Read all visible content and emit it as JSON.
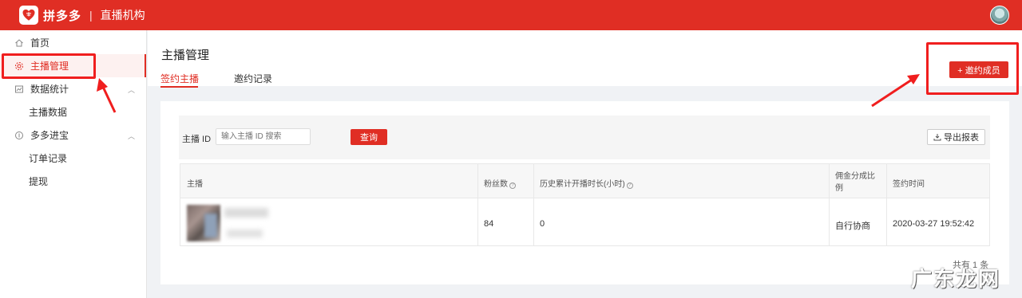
{
  "header": {
    "brand": "拼多多",
    "separator": "|",
    "subtitle": "直播机构"
  },
  "sidebar": {
    "items": [
      {
        "label": "首页",
        "icon": "home-icon"
      },
      {
        "label": "主播管理",
        "icon": "gear-icon",
        "active": true
      },
      {
        "label": "数据统计",
        "icon": "chart-icon"
      },
      {
        "label": "主播数据",
        "sub": true
      },
      {
        "label": "多多进宝",
        "icon": "coin-icon"
      },
      {
        "label": "订单记录",
        "sub": true
      },
      {
        "label": "提现",
        "sub": true
      }
    ]
  },
  "main": {
    "title": "主播管理",
    "tabs": [
      {
        "label": "签约主播",
        "active": true
      },
      {
        "label": "邀约记录"
      }
    ],
    "invite_button": "+ 邀约成员"
  },
  "filter": {
    "label": "主播 ID",
    "placeholder": "输入主播 ID 搜索",
    "query_button": "查询",
    "export_button": "导出报表"
  },
  "table": {
    "headers": [
      "主播",
      "粉丝数",
      "历史累计开播时长(小时)",
      "佣金分成比例",
      "签约时间"
    ],
    "rows": [
      {
        "fans": "84",
        "hours": "0",
        "commission": "自行协商",
        "signed_at": "2020-03-27 19:52:42"
      }
    ],
    "total": "共有 1 条"
  },
  "watermark": "广东龙网",
  "colors": {
    "brand": "#e02e24",
    "annotation": "#f01e1e"
  }
}
